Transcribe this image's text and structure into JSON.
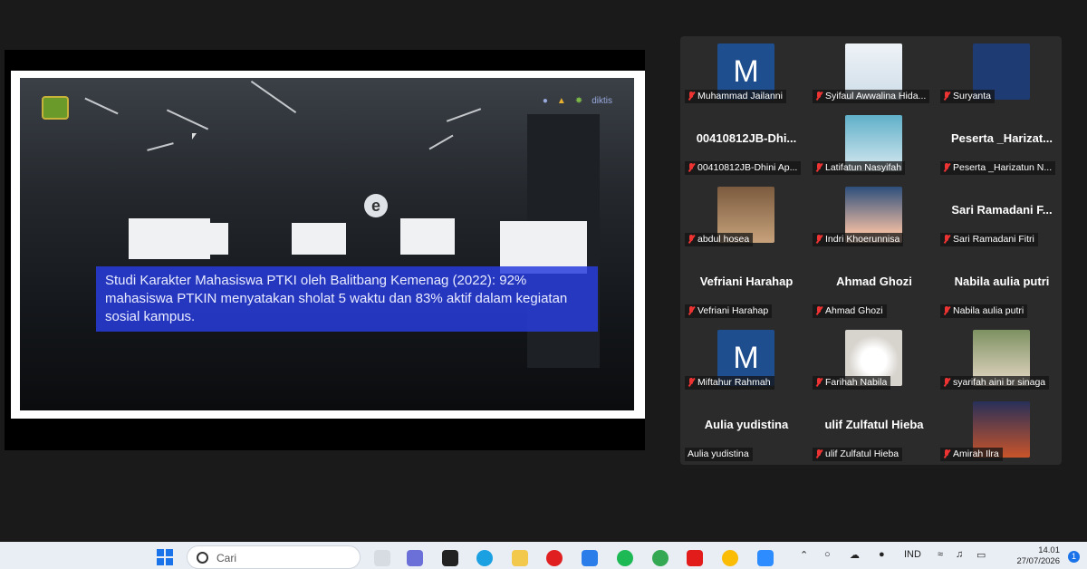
{
  "slide": {
    "caption": "Studi Karakter Mahasiswa PTKI oleh Balitbang Kemenag (2022): 92% mahasiswa PTKIN menyatakan sholat 5 waktu dan 83% aktif dalam kegiatan sosial kampus.",
    "e_logo": "e",
    "partner_logo_text": "diktis"
  },
  "participants": [
    {
      "name": "Muhammad Jailanni",
      "avatar": "letter",
      "letter": "M",
      "muted": true
    },
    {
      "name": "Syifaul Awwalina Hida...",
      "avatar": "photo",
      "muted": true
    },
    {
      "name": "Suryanta",
      "avatar": "plain",
      "muted": true
    },
    {
      "name": "00410812JB-Dhini Ap...",
      "display_big": "00410812JB-Dhi...",
      "avatar": "none",
      "muted": true
    },
    {
      "name": "Latifatun Nasyifah",
      "avatar": "photo",
      "muted": true
    },
    {
      "name": "Peserta _Harizatun N...",
      "display_big": "Peserta _Harizat...",
      "avatar": "none",
      "muted": true
    },
    {
      "name": "abdul hosea",
      "avatar": "photo",
      "muted": true
    },
    {
      "name": "Indri Khoerunnisa",
      "avatar": "photo",
      "muted": true
    },
    {
      "name": "Sari Ramadani Fitri",
      "display_big": "Sari Ramadani F...",
      "avatar": "none",
      "muted": true
    },
    {
      "name": "Vefriani Harahap",
      "display_big": "Vefriani Harahap",
      "avatar": "none",
      "muted": true
    },
    {
      "name": "Ahmad Ghozi",
      "display_big": "Ahmad Ghozi",
      "avatar": "none",
      "muted": true
    },
    {
      "name": "Nabila aulia putri",
      "display_big": "Nabila aulia putri",
      "avatar": "none",
      "muted": true
    },
    {
      "name": "Miftahur Rahmah",
      "avatar": "letter",
      "letter": "M",
      "muted": true
    },
    {
      "name": "Farihah Nabila",
      "avatar": "photo",
      "muted": true
    },
    {
      "name": "syarifah aini br sinaga",
      "avatar": "photo",
      "muted": true
    },
    {
      "name": "Aulia yudistina",
      "display_big": "Aulia yudistina",
      "avatar": "none",
      "muted": false
    },
    {
      "name": "ulif Zulfatul Hieba",
      "display_big": "ulif Zulfatul Hieba",
      "avatar": "none",
      "muted": true
    },
    {
      "name": "Amirah Ilra",
      "avatar": "photo",
      "muted": true
    }
  ],
  "taskbar": {
    "search_placeholder": "Cari",
    "language": "IND",
    "time": "14.01",
    "date": "27/07/2026",
    "notification_count": "1"
  },
  "colors": {
    "caption_bg": "#2838dc",
    "avatar_blue": "#1f4e8f",
    "muted_red": "#e33333"
  }
}
